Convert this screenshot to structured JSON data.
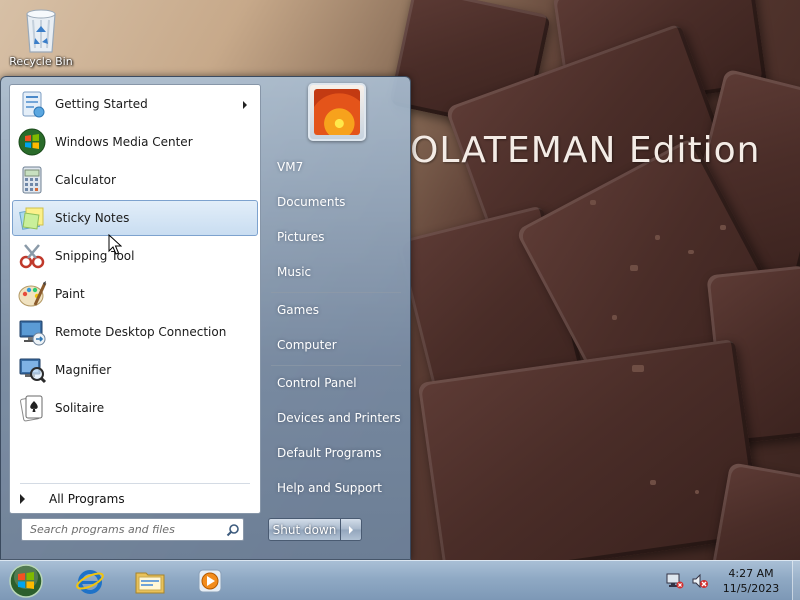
{
  "desktop": {
    "wallpaper_text": "OLATEMAN Edition",
    "icons": [
      {
        "label": "Recycle Bin",
        "icon": "recycle-bin-icon"
      }
    ]
  },
  "start_menu": {
    "programs": [
      {
        "label": "Getting Started",
        "icon": "getting-started-icon",
        "has_submenu": true
      },
      {
        "label": "Windows Media Center",
        "icon": "media-center-icon"
      },
      {
        "label": "Calculator",
        "icon": "calculator-icon"
      },
      {
        "label": "Sticky Notes",
        "icon": "sticky-notes-icon",
        "selected": true
      },
      {
        "label": "Snipping Tool",
        "icon": "snipping-tool-icon"
      },
      {
        "label": "Paint",
        "icon": "paint-icon"
      },
      {
        "label": "Remote Desktop Connection",
        "icon": "remote-desktop-icon"
      },
      {
        "label": "Magnifier",
        "icon": "magnifier-icon"
      },
      {
        "label": "Solitaire",
        "icon": "solitaire-icon"
      }
    ],
    "all_programs_label": "All Programs",
    "search": {
      "placeholder": "Search programs and files",
      "value": ""
    },
    "right_items": [
      "VM7",
      "Documents",
      "Pictures",
      "Music",
      "Games",
      "Computer",
      "Control Panel",
      "Devices and Printers",
      "Default Programs",
      "Help and Support"
    ],
    "shutdown_label": "Shut down"
  },
  "taskbar": {
    "pinned": [
      {
        "name": "Internet Explorer",
        "icon": "internet-explorer-icon"
      },
      {
        "name": "Windows Explorer",
        "icon": "file-explorer-icon"
      },
      {
        "name": "Windows Media Player",
        "icon": "media-player-icon"
      }
    ],
    "tray_icons": [
      "network-icon",
      "volume-muted-icon"
    ],
    "clock": {
      "time": "4:27 AM",
      "date": "11/5/2023"
    }
  },
  "colors": {
    "selection": "#c9ddf1",
    "taskbar": "#8fa9c4",
    "menu_glass": "#7a92ae"
  }
}
